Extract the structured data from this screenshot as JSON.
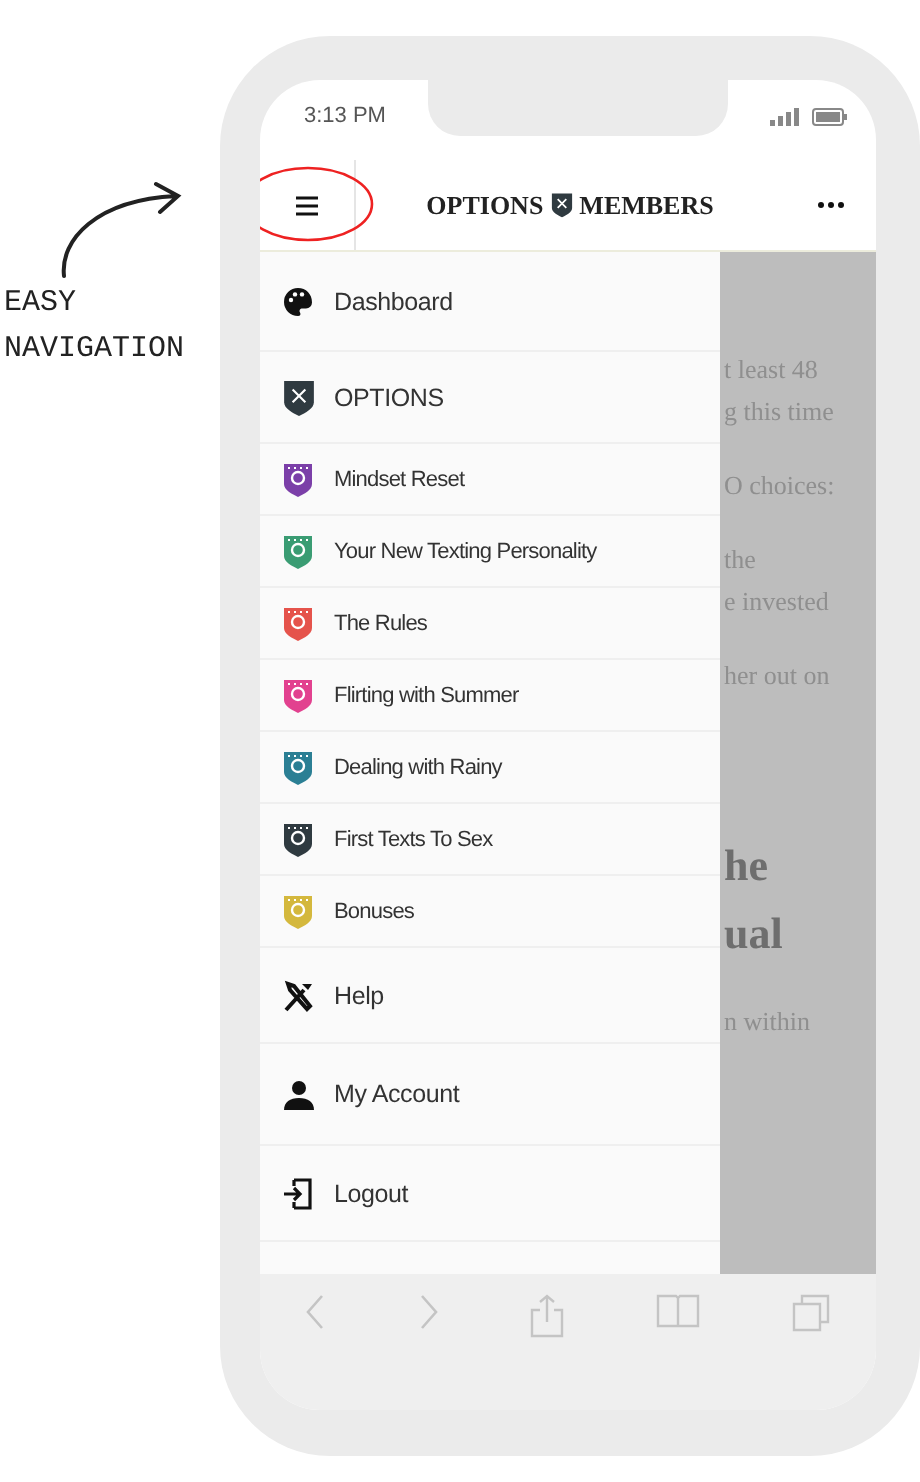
{
  "annotation": {
    "lines": [
      "EASY",
      "NAVIGATION"
    ]
  },
  "status_bar": {
    "time": "3:13 PM"
  },
  "header": {
    "title_left": "OPTIONS",
    "title_right": "MEMBERS"
  },
  "menu": {
    "items": [
      {
        "label": "Dashboard",
        "kind": "link"
      },
      {
        "label": "OPTIONS",
        "kind": "section"
      },
      {
        "label": "Mindset Reset",
        "kind": "course",
        "color": "#7b3fa8"
      },
      {
        "label": "Your New Texting Personality",
        "kind": "course",
        "color": "#3a9c73"
      },
      {
        "label": "The Rules",
        "kind": "course",
        "color": "#e5534b"
      },
      {
        "label": "Flirting with Summer",
        "kind": "course",
        "color": "#e2418f"
      },
      {
        "label": "Dealing with Rainy",
        "kind": "course",
        "color": "#2b7f94"
      },
      {
        "label": "First Texts To Sex",
        "kind": "course",
        "color": "#2f3a40"
      },
      {
        "label": "Bonuses",
        "kind": "course",
        "color": "#d4b83d"
      },
      {
        "label": "Help",
        "kind": "link"
      },
      {
        "label": "My Account",
        "kind": "link"
      },
      {
        "label": "Logout",
        "kind": "link"
      }
    ]
  },
  "background_page": {
    "paragraphs": [
      [
        "t least 48",
        "g this time"
      ],
      [
        "O choices:"
      ],
      [
        "the",
        "e invested"
      ],
      [
        "her out on"
      ]
    ],
    "heading": [
      "he",
      "ual"
    ],
    "after": [
      "n within"
    ]
  }
}
